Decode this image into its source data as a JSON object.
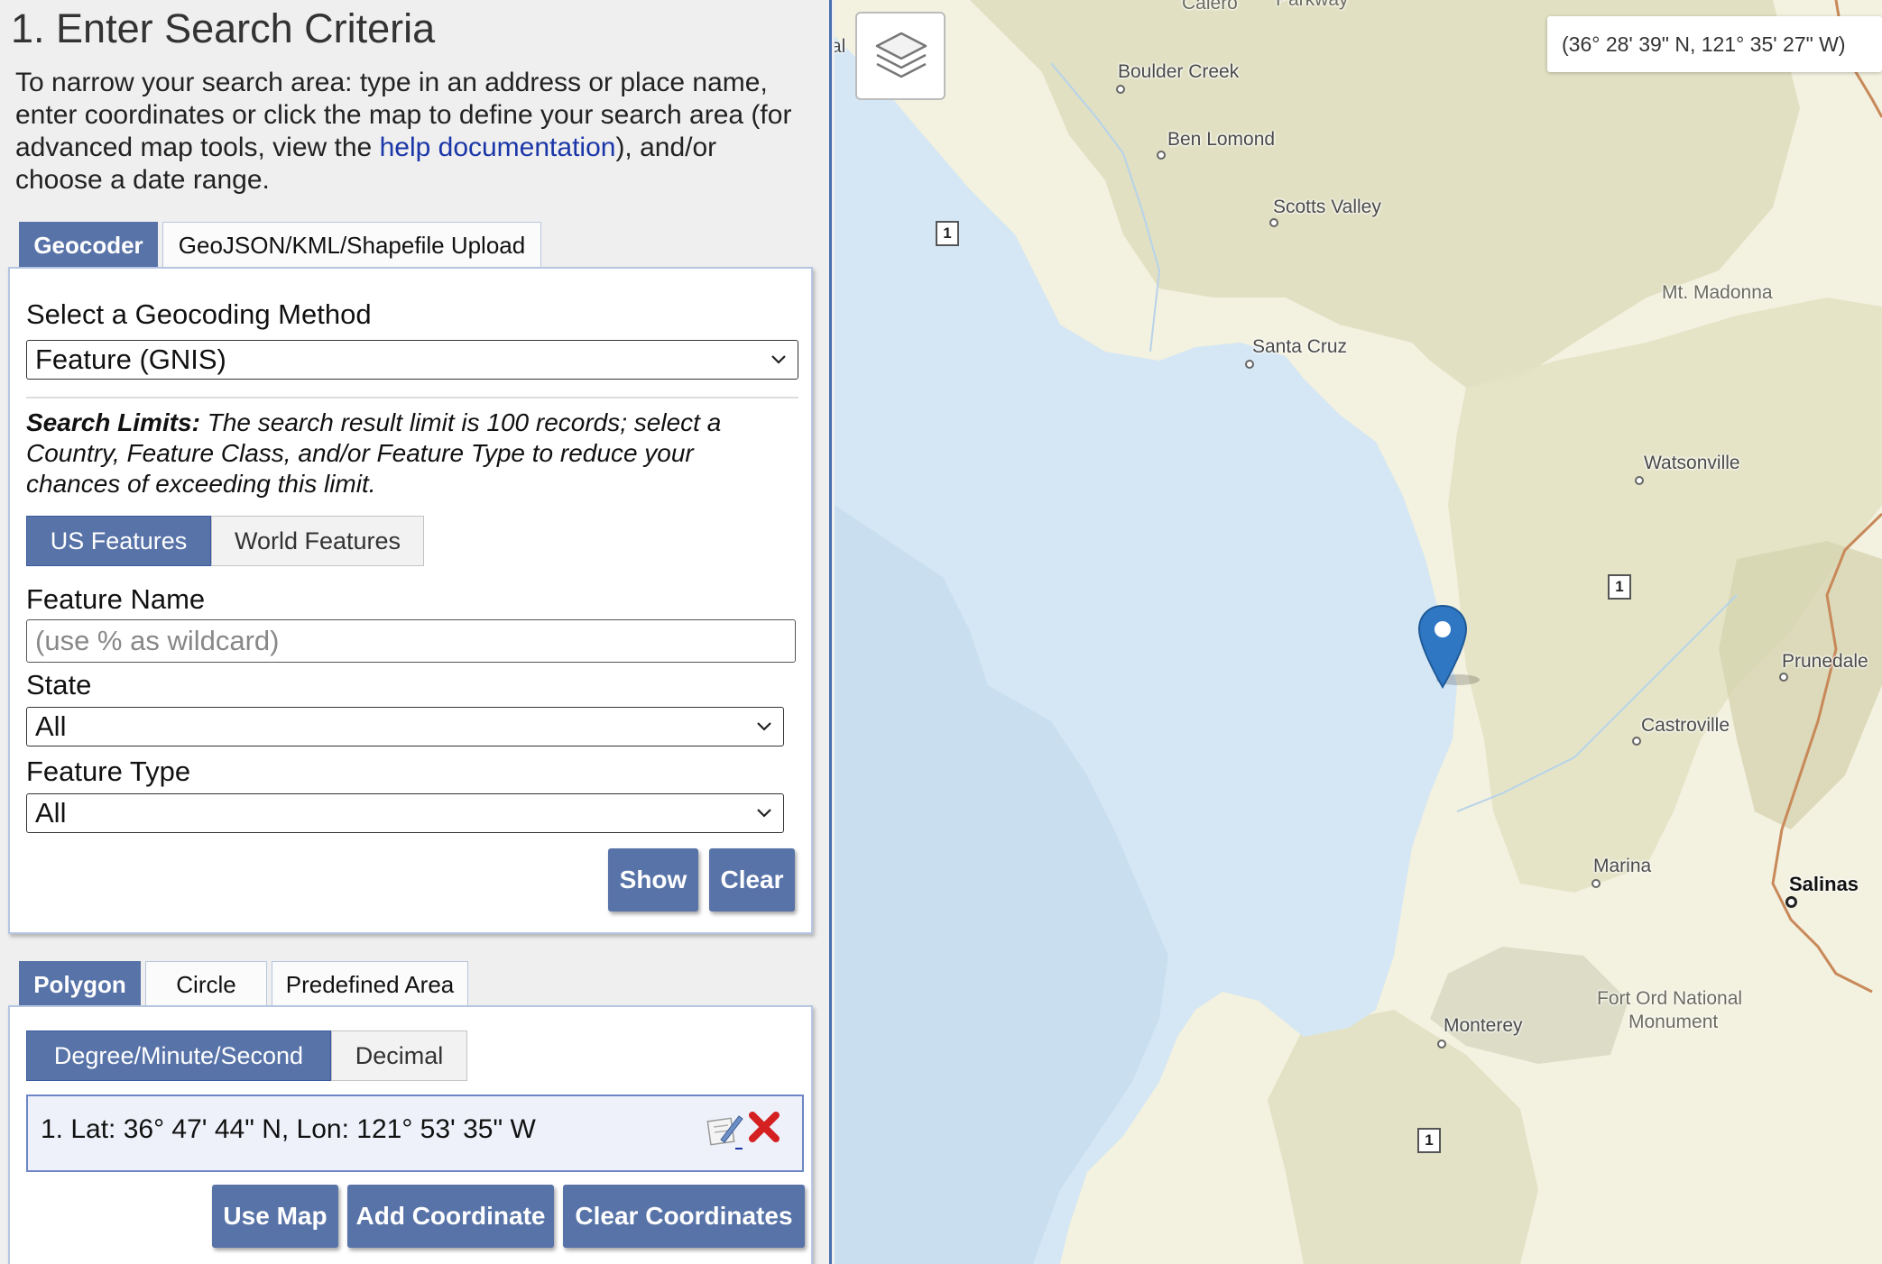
{
  "page": {
    "title": "1. Enter Search Criteria",
    "intro_before": "To narrow your search area: type in an address or place name, enter coordinates or click the map to define your search area (for advanced map tools, view the ",
    "intro_link": "help documentation",
    "intro_after": "), and/or choose a date range."
  },
  "geo_tabs": [
    {
      "label": "Geocoder",
      "active": true
    },
    {
      "label": "GeoJSON/KML/Shapefile Upload",
      "active": false
    }
  ],
  "geocoder": {
    "method_label": "Select a Geocoding Method",
    "method_value": "Feature (GNIS)",
    "limits_bold": "Search Limits:",
    "limits_text": " The search result limit is 100 records; select a Country, Feature Class, and/or Feature Type to reduce your chances of exceeding this limit.",
    "feature_toggle": [
      {
        "label": "US Features",
        "active": true
      },
      {
        "label": "World Features",
        "active": false
      }
    ],
    "feature_name_label": "Feature Name",
    "feature_name_placeholder": "(use % as wildcard)",
    "state_label": "State",
    "state_value": "All",
    "feature_type_label": "Feature Type",
    "feature_type_value": "All",
    "show_label": "Show",
    "clear_label": "Clear"
  },
  "area_tabs": [
    {
      "label": "Polygon",
      "active": true
    },
    {
      "label": "Circle",
      "active": false
    },
    {
      "label": "Predefined Area",
      "active": false
    }
  ],
  "polygon": {
    "format_toggle": [
      {
        "label": "Degree/Minute/Second",
        "active": true
      },
      {
        "label": "Decimal",
        "active": false
      }
    ],
    "coordinates": [
      "1.  Lat: 36° 47' 44\" N, Lon: 121° 53' 35\" W"
    ],
    "use_map_label": "Use Map",
    "add_coordinate_label": "Add Coordinate",
    "clear_coordinates_label": "Clear Coordinates"
  },
  "map": {
    "cursor_readout": "(36° 28' 39\" N, 121° 35' 27\" W)",
    "places": {
      "boulder_creek": "Boulder Creek",
      "ben_lomond": "Ben Lomond",
      "scotts_valley": "Scotts Valley",
      "mt_madonna": "Mt. Madonna",
      "santa_cruz": "Santa Cruz",
      "watsonville": "Watsonville",
      "prunedale": "Prunedale",
      "castroville": "Castroville",
      "marina": "Marina",
      "salinas": "Salinas",
      "fort_ord_1": "Fort Ord National",
      "fort_ord_2": "Monument",
      "monterey": "Monterey",
      "partial_top": "Calero",
      "partial_top2": "Parkway",
      "partial_left": "al"
    },
    "highway_label": "1",
    "colors": {
      "water": "#d5e7f4",
      "deep_water": "#c8def0",
      "land": "#f3f1df",
      "terrain": "#dcdcba",
      "accent": "#5873a8",
      "road": "#c8895a",
      "marker": "#2f77c3"
    }
  }
}
